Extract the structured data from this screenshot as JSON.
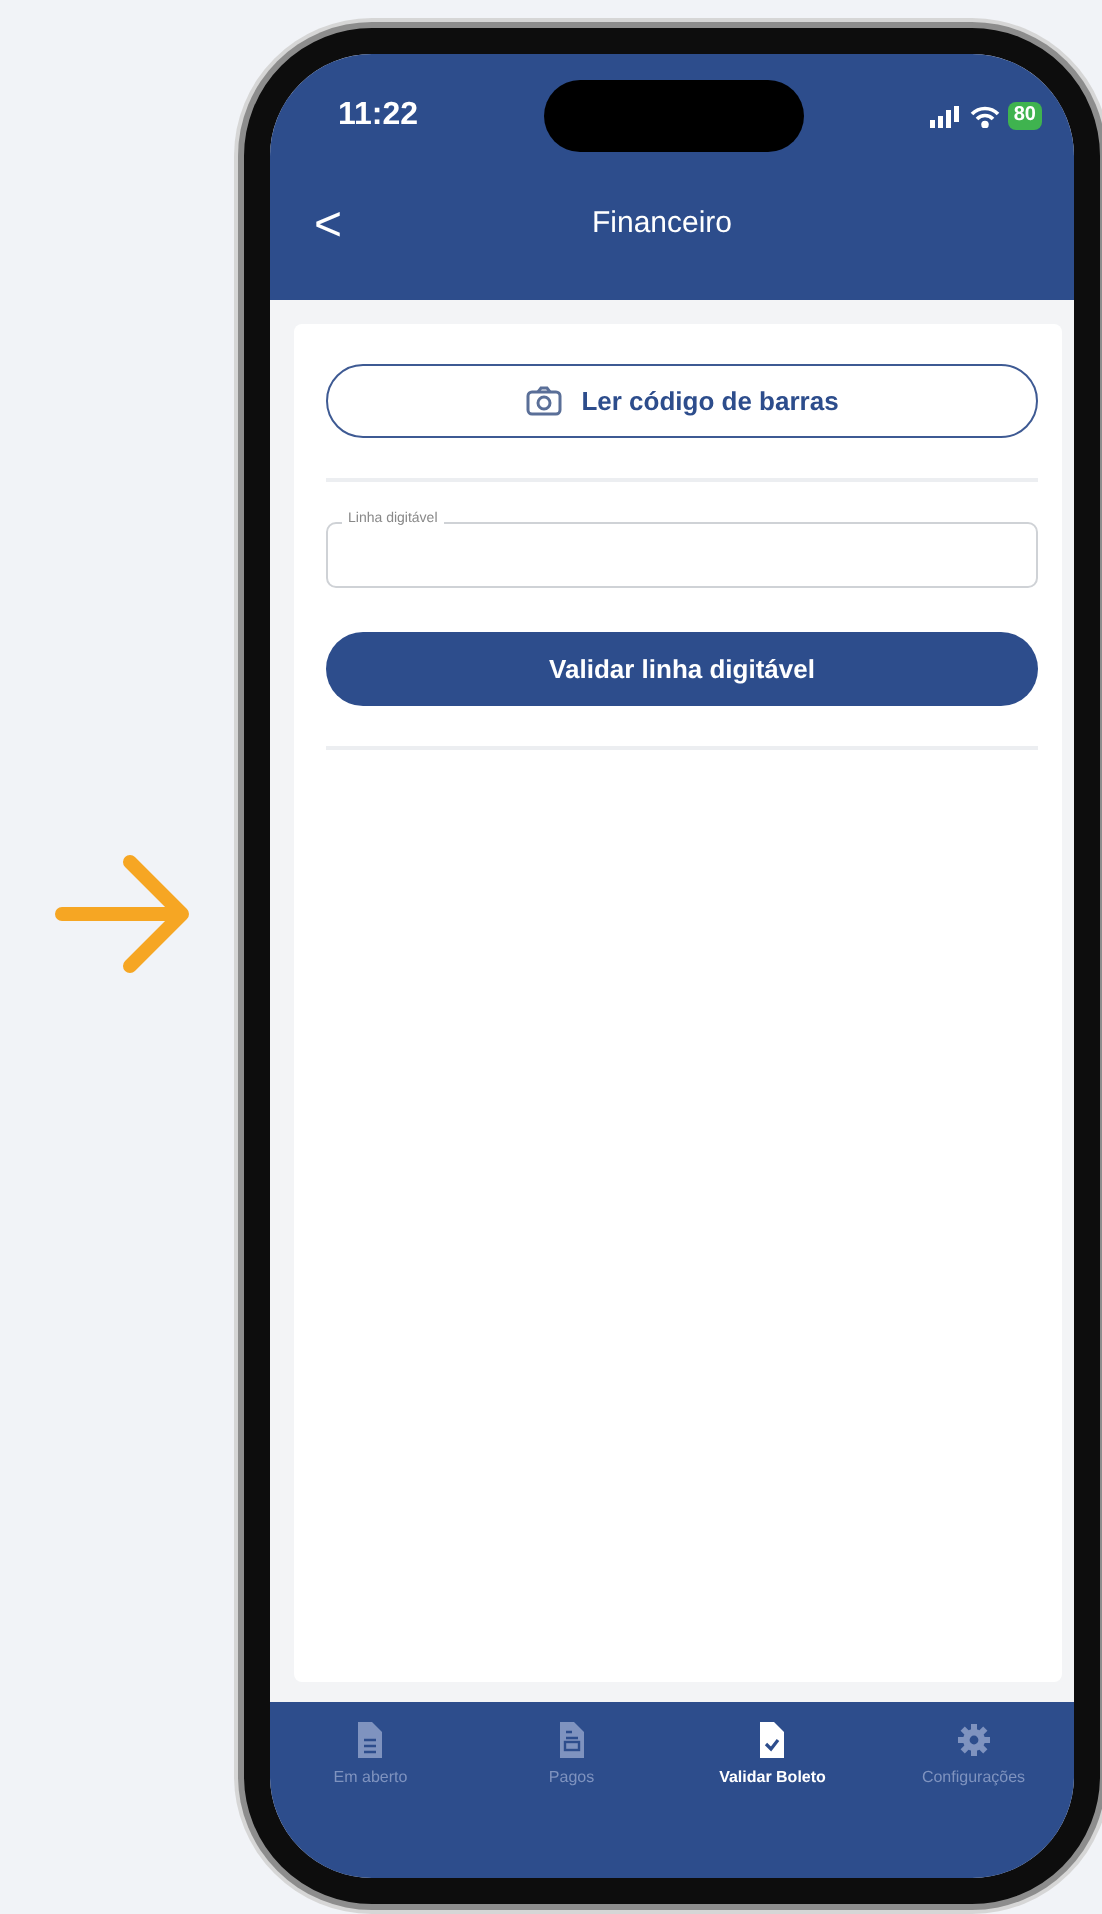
{
  "status_bar": {
    "time": "11:22",
    "battery": "80"
  },
  "header": {
    "back": "<",
    "title": "Financeiro"
  },
  "scan_button": {
    "label": "Ler código de barras"
  },
  "line_field": {
    "label": "Linha digitável"
  },
  "validate_button": {
    "label": "Validar linha digitável"
  },
  "tabs": [
    {
      "kind": "document",
      "label": "Em aberto",
      "selected": false
    },
    {
      "kind": "receipt",
      "label": "Pagos",
      "selected": false
    },
    {
      "kind": "check",
      "label": "Validar Boleto",
      "selected": true
    },
    {
      "kind": "gear",
      "label": "Configurações",
      "selected": false
    }
  ]
}
